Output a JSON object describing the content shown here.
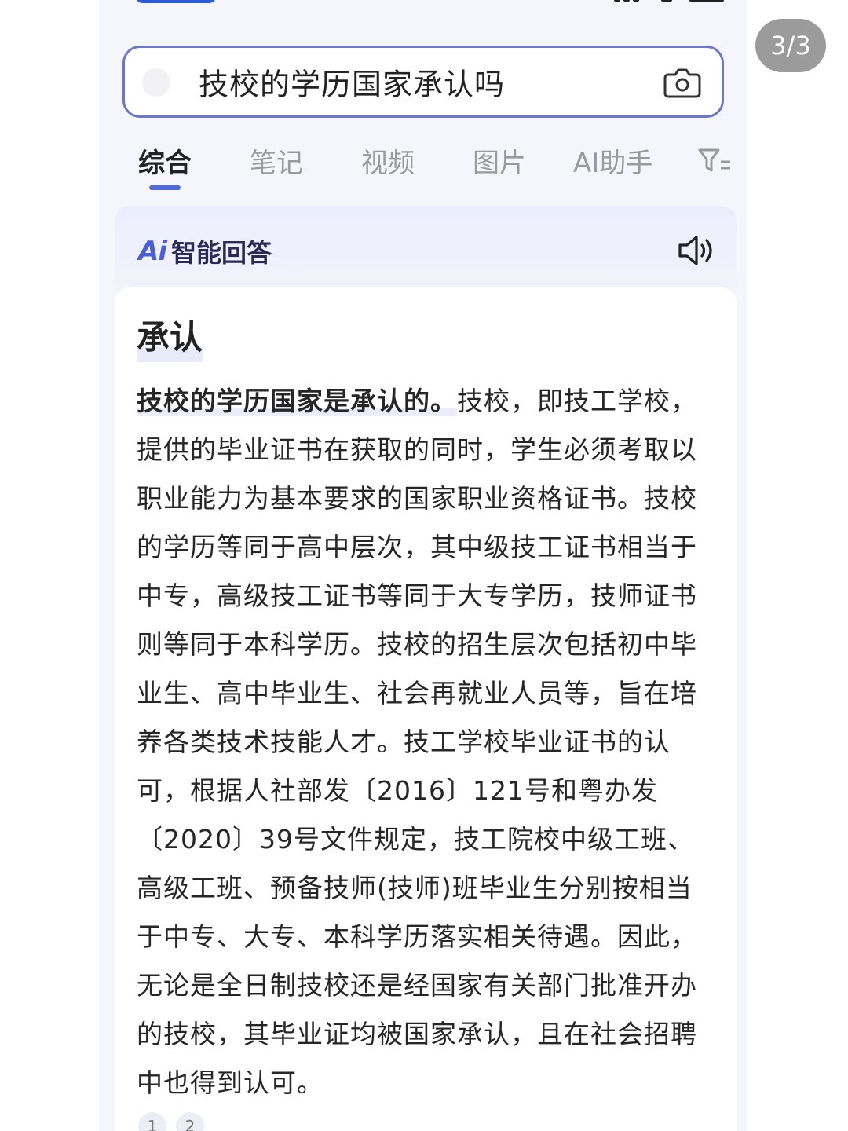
{
  "page_indicator": "3/3",
  "search": {
    "query": "技校的学历国家承认吗"
  },
  "tabs": [
    {
      "label": "综合",
      "active": true
    },
    {
      "label": "笔记",
      "active": false
    },
    {
      "label": "视频",
      "active": false
    },
    {
      "label": "图片",
      "active": false
    },
    {
      "label": "AI助手",
      "active": false
    }
  ],
  "ai_answer": {
    "logo": "Ai",
    "title": "智能回答",
    "keyword": "承认",
    "lead": "技校的学历国家是承认的。",
    "body": "技校，即技工学校，提供的毕业证书在获取的同时，学生必须考取以职业能力为基本要求的国家职业资格证书。技校的学历等同于高中层次，其中级技工证书相当于中专，高级技工证书等同于大专学历，技师证书则等同于本科学历。技校的招生层次包括初中毕业生、高中毕业生、社会再就业人员等，旨在培养各类技术技能人才。技工学校毕业证书的认可，根据人社部发〔2016〕121号和粤办发〔2020〕39号文件规定，技工院校中级工班、高级工班、预备技师(技师)班毕业生分别按相当于中专、大专、本科学历落实相关待遇。因此，无论是全日制技校还是经国家有关部门批准开办的技校，其毕业证均被国家承认，且在社会招聘中也得到认可。",
    "references": [
      "1",
      "2"
    ]
  },
  "colors": {
    "accent": "#4e6bd9",
    "search_border": "#6a78c9",
    "page_indicator_bg": "#9b9b9b"
  },
  "icons": {
    "camera": "camera-icon",
    "filter": "filter-icon",
    "speaker": "speaker-icon"
  }
}
